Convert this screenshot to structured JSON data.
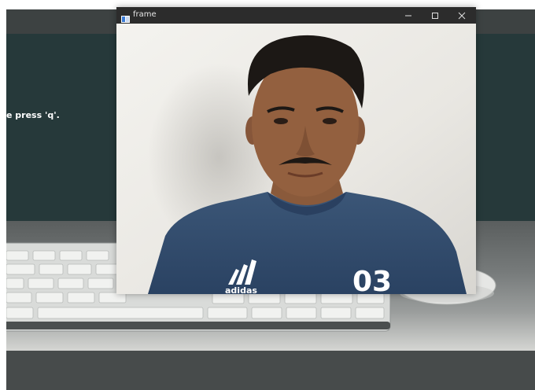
{
  "background_app": {
    "message": "e press 'q'."
  },
  "frame_window": {
    "title": "frame",
    "controls": {
      "minimize": "minimize-icon",
      "maximize": "maximize-icon",
      "close": "close-icon"
    }
  },
  "video": {
    "shirt_number": "03",
    "shirt_logo_text": "adidas"
  },
  "colors": {
    "background_app": "#26393a",
    "titlebar": "#2c2c2c",
    "wall": "#ebe9e4",
    "shirt": "#2f4a6a"
  }
}
